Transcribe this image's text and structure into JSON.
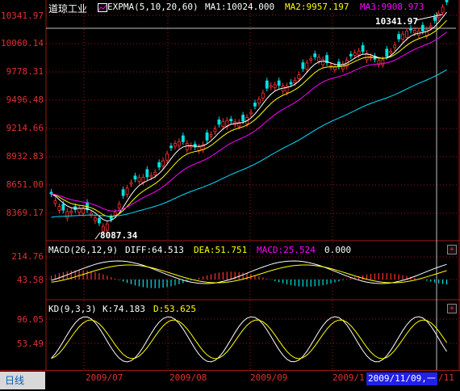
{
  "title": "道琼工业",
  "indicator_name": "EXPMA(5,10,20,60)",
  "ma1": "MA1:10024.000",
  "ma2": "MA2:9957.197",
  "ma3": "MA3:9908.973",
  "price_ticks": [
    "10341.97",
    "10060.14",
    "9778.31",
    "9496.48",
    "9214.66",
    "8932.83",
    "8651.00",
    "8369.17"
  ],
  "high_label": "10341.97",
  "low_label": "8087.34",
  "macd": {
    "name": "MACD(26,12,9)",
    "diff": "DIFF:64.513",
    "dea": "DEA:51.751",
    "macd": "MACD:25.524",
    "zero": "0.000",
    "ticks": [
      "214.76",
      "43.58"
    ]
  },
  "kd": {
    "name": "KD(9,3,3)",
    "k": "K:74.183",
    "d": "D:53.625",
    "ticks": [
      "96.05",
      "53.49"
    ]
  },
  "bottom": {
    "period_tab": "日线",
    "dates": [
      "2009/07",
      "2009/08",
      "2009/09",
      "2009/1"
    ],
    "cursor_date": "2009/11/09,一",
    "tail_date": "/11"
  },
  "colors": {
    "up": "#ff3030",
    "down": "#00e0e0",
    "ema_white": "#ffffff",
    "ema_yellow": "#ffff00",
    "ema_magenta": "#ff00ff",
    "ema_cyan": "#00e0ff",
    "grid": "#a01818",
    "tick": "#e03030"
  },
  "icons": {
    "add_indicator": "plus-icon",
    "expma_icon": "indicator-chart-icon"
  },
  "add_button_label": "+"
}
